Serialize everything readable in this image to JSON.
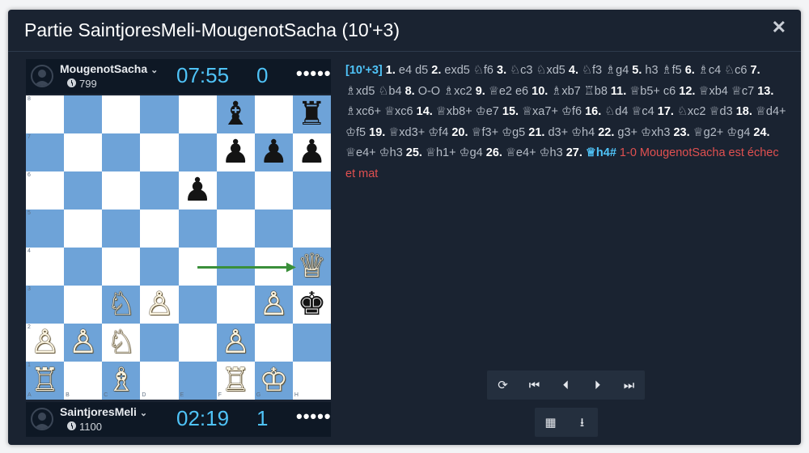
{
  "dialog": {
    "title": "Partie SaintjoresMeli-MougenotSacha (10'+3)",
    "close_icon": "close-icon"
  },
  "top_player": {
    "name": "MougenotSacha",
    "rating": "799",
    "clock": "07:55",
    "score": "0",
    "menu": "•••••"
  },
  "bottom_player": {
    "name": "SaintjoresMeli",
    "rating": "1100",
    "clock": "02:19",
    "score": "1",
    "menu": "•••••"
  },
  "board": {
    "ranks": [
      "8",
      "7",
      "6",
      "5",
      "4",
      "3",
      "2",
      "1"
    ],
    "files": [
      "A",
      "B",
      "C",
      "D",
      "E",
      "F",
      "G",
      "H"
    ],
    "light_color": "#ffffff",
    "dark_color": "#6ea3d8",
    "arrow_color": "#3a8f3a",
    "arrow": {
      "from": "e4",
      "to": "h4"
    },
    "pieces": [
      {
        "sq": "f8",
        "glyph": "♝",
        "side": "b"
      },
      {
        "sq": "h8",
        "glyph": "♜",
        "side": "b"
      },
      {
        "sq": "f7",
        "glyph": "♟",
        "side": "b"
      },
      {
        "sq": "g7",
        "glyph": "♟",
        "side": "b"
      },
      {
        "sq": "h7",
        "glyph": "♟",
        "side": "b"
      },
      {
        "sq": "e6",
        "glyph": "♟",
        "side": "b"
      },
      {
        "sq": "h4",
        "glyph": "♕",
        "side": "w"
      },
      {
        "sq": "c3",
        "glyph": "♘",
        "side": "w"
      },
      {
        "sq": "d3",
        "glyph": "♙",
        "side": "w"
      },
      {
        "sq": "g3",
        "glyph": "♙",
        "side": "w"
      },
      {
        "sq": "h3",
        "glyph": "♚",
        "side": "b"
      },
      {
        "sq": "a2",
        "glyph": "♙",
        "side": "w"
      },
      {
        "sq": "b2",
        "glyph": "♙",
        "side": "w"
      },
      {
        "sq": "c2",
        "glyph": "♘",
        "side": "w"
      },
      {
        "sq": "f2",
        "glyph": "♙",
        "side": "w"
      },
      {
        "sq": "a1",
        "glyph": "♖",
        "side": "w"
      },
      {
        "sq": "c1",
        "glyph": "♗",
        "side": "w"
      },
      {
        "sq": "f1",
        "glyph": "♖",
        "side": "w"
      },
      {
        "sq": "g1",
        "glyph": "♔",
        "side": "w"
      }
    ]
  },
  "moves": {
    "time_control": "[10'+3]",
    "list": [
      {
        "n": "1.",
        "w": "e4",
        "b": "d5"
      },
      {
        "n": "2.",
        "w": "exd5",
        "b": "♘f6"
      },
      {
        "n": "3.",
        "w": "♘c3",
        "b": "♘xd5"
      },
      {
        "n": "4.",
        "w": "♘f3",
        "b": "♗g4"
      },
      {
        "n": "5.",
        "w": "h3",
        "b": "♗f5"
      },
      {
        "n": "6.",
        "w": "♗c4",
        "b": "♘c6"
      },
      {
        "n": "7.",
        "w": "♗xd5",
        "b": "♘b4"
      },
      {
        "n": "8.",
        "w": "O-O",
        "b": "♗xc2"
      },
      {
        "n": "9.",
        "w": "♕e2",
        "b": "e6"
      },
      {
        "n": "10.",
        "w": "♗xb7",
        "b": "♖b8"
      },
      {
        "n": "11.",
        "w": "♕b5+",
        "b": "c6"
      },
      {
        "n": "12.",
        "w": "♕xb4",
        "b": "♕c7"
      },
      {
        "n": "13.",
        "w": "♗xc6+",
        "b": "♕xc6"
      },
      {
        "n": "14.",
        "w": "♕xb8+",
        "b": "♔e7"
      },
      {
        "n": "15.",
        "w": "♕xa7+",
        "b": "♔f6"
      },
      {
        "n": "16.",
        "w": "♘d4",
        "b": "♕c4"
      },
      {
        "n": "17.",
        "w": "♘xc2",
        "b": "♕d3"
      },
      {
        "n": "18.",
        "w": "♕d4+",
        "b": "♔f5"
      },
      {
        "n": "19.",
        "w": "♕xd3+",
        "b": "♔f4"
      },
      {
        "n": "20.",
        "w": "♕f3+",
        "b": "♔g5"
      },
      {
        "n": "21.",
        "w": "d3+",
        "b": "♔h4"
      },
      {
        "n": "22.",
        "w": "g3+",
        "b": "♔xh3"
      },
      {
        "n": "23.",
        "w": "♕g2+",
        "b": "♔g4"
      },
      {
        "n": "24.",
        "w": "♕e4+",
        "b": "♔h3"
      },
      {
        "n": "25.",
        "w": "♕h1+",
        "b": "♔g4"
      },
      {
        "n": "26.",
        "w": "♕e4+",
        "b": "♔h3"
      },
      {
        "n": "27.",
        "w": "♕h4#",
        "b": ""
      }
    ],
    "result": "1-0 MougenotSacha est échec et mat"
  },
  "controls": {
    "flip": "⟳",
    "first": "⏮",
    "prev": "⏴",
    "next": "⏵",
    "last": "⏭",
    "engine": "▦",
    "download": "⭳"
  }
}
